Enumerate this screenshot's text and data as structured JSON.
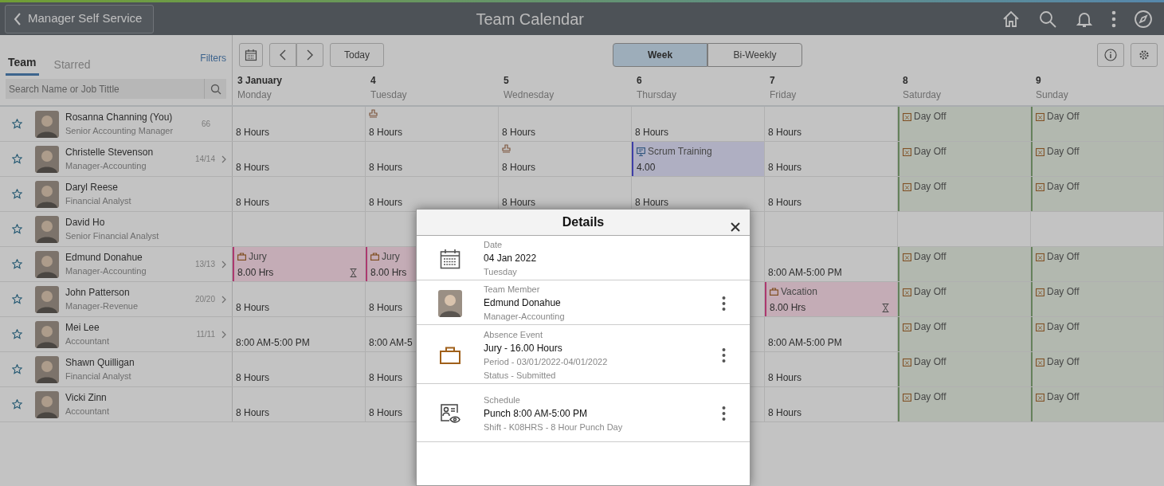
{
  "header": {
    "back_label": "Manager Self Service",
    "title": "Team Calendar"
  },
  "sidebar": {
    "tabs": [
      {
        "label": "Team",
        "selected": true
      },
      {
        "label": "Starred",
        "selected": false
      }
    ],
    "filters": "Filters",
    "search": {
      "placeholder": "Search Name or Job Tittle"
    }
  },
  "toolbar": {
    "today": "Today",
    "views": [
      {
        "label": "Week",
        "selected": true
      },
      {
        "label": "Bi-Weekly",
        "selected": false
      }
    ]
  },
  "days": [
    {
      "date": "3 January",
      "weekday": "Monday"
    },
    {
      "date": "4",
      "weekday": "Tuesday"
    },
    {
      "date": "5",
      "weekday": "Wednesday"
    },
    {
      "date": "6",
      "weekday": "Thursday"
    },
    {
      "date": "7",
      "weekday": "Friday"
    },
    {
      "date": "8",
      "weekday": "Saturday"
    },
    {
      "date": "9",
      "weekday": "Sunday"
    }
  ],
  "rows": [
    {
      "name": "Rosanna Channing (You)",
      "job": "Senior Accounting Manager",
      "count": "66",
      "expandable": false,
      "starred": false,
      "cells": [
        {
          "kind": "hours",
          "text": "8 Hours"
        },
        {
          "kind": "hours",
          "text": "8 Hours",
          "flagged": true
        },
        {
          "kind": "hours",
          "text": "8 Hours"
        },
        {
          "kind": "hours",
          "text": "8 Hours"
        },
        {
          "kind": "hours",
          "text": "8 Hours"
        },
        {
          "kind": "dayoff",
          "title": "Day Off"
        },
        {
          "kind": "dayoff",
          "title": "Day Off"
        }
      ]
    },
    {
      "name": "Christelle Stevenson",
      "job": "Manager-Accounting",
      "count": "14/14",
      "expandable": true,
      "starred": false,
      "cells": [
        {
          "kind": "hours",
          "text": "8 Hours"
        },
        {
          "kind": "hours",
          "text": "8 Hours"
        },
        {
          "kind": "hours",
          "text": "8 Hours",
          "flagged": true
        },
        {
          "kind": "training",
          "title": "Scrum Training",
          "text": "4.00"
        },
        {
          "kind": "hours",
          "text": "8 Hours"
        },
        {
          "kind": "dayoff",
          "title": "Day Off"
        },
        {
          "kind": "dayoff",
          "title": "Day Off"
        }
      ]
    },
    {
      "name": "Daryl Reese",
      "job": "Financial Analyst",
      "starred": false,
      "cells": [
        {
          "kind": "hours",
          "text": "8 Hours"
        },
        {
          "kind": "hours",
          "text": "8 Hours"
        },
        {
          "kind": "hours",
          "text": "8 Hours"
        },
        {
          "kind": "hours",
          "text": "8 Hours"
        },
        {
          "kind": "hours",
          "text": "8 Hours"
        },
        {
          "kind": "dayoff",
          "title": "Day Off"
        },
        {
          "kind": "dayoff",
          "title": "Day Off"
        }
      ]
    },
    {
      "name": "David Ho",
      "job": "Senior Financial Analyst",
      "starred": false,
      "cells": [
        {
          "kind": "empty"
        },
        {
          "kind": "empty"
        },
        {
          "kind": "empty"
        },
        {
          "kind": "empty"
        },
        {
          "kind": "empty"
        },
        {
          "kind": "empty"
        },
        {
          "kind": "empty"
        }
      ]
    },
    {
      "name": "Edmund Donahue",
      "job": "Manager-Accounting",
      "count": "13/13",
      "expandable": true,
      "starred": false,
      "cells": [
        {
          "kind": "absence",
          "title": "Jury",
          "text": "8.00 Hrs",
          "pending": true
        },
        {
          "kind": "absence",
          "title": "Jury",
          "text": "8.00 Hrs"
        },
        {
          "kind": "empty"
        },
        {
          "kind": "empty"
        },
        {
          "kind": "hours",
          "text": "8:00 AM-5:00 PM"
        },
        {
          "kind": "dayoff",
          "title": "Day Off"
        },
        {
          "kind": "dayoff",
          "title": "Day Off"
        }
      ]
    },
    {
      "name": "John Patterson",
      "job": "Manager-Revenue",
      "count": "20/20",
      "expandable": true,
      "starred": false,
      "cells": [
        {
          "kind": "hours",
          "text": "8 Hours"
        },
        {
          "kind": "hours",
          "text": "8 Hours"
        },
        {
          "kind": "empty"
        },
        {
          "kind": "empty"
        },
        {
          "kind": "absence",
          "title": "Vacation",
          "text": "8.00 Hrs",
          "pending": true
        },
        {
          "kind": "dayoff",
          "title": "Day Off"
        },
        {
          "kind": "dayoff",
          "title": "Day Off"
        }
      ]
    },
    {
      "name": "Mei Lee",
      "job": "Accountant",
      "count": "11/11",
      "expandable": true,
      "starred": false,
      "cells": [
        {
          "kind": "hours",
          "text": "8:00 AM-5:00 PM"
        },
        {
          "kind": "hours",
          "text": "8:00 AM-5"
        },
        {
          "kind": "empty"
        },
        {
          "kind": "empty"
        },
        {
          "kind": "hours",
          "text": "8:00 AM-5:00 PM"
        },
        {
          "kind": "dayoff",
          "title": "Day Off"
        },
        {
          "kind": "dayoff",
          "title": "Day Off"
        }
      ]
    },
    {
      "name": "Shawn Quilligan",
      "job": "Financial Analyst",
      "starred": false,
      "cells": [
        {
          "kind": "hours",
          "text": "8 Hours"
        },
        {
          "kind": "hours",
          "text": "8 Hours"
        },
        {
          "kind": "empty"
        },
        {
          "kind": "empty"
        },
        {
          "kind": "hours",
          "text": "8 Hours"
        },
        {
          "kind": "dayoff",
          "title": "Day Off"
        },
        {
          "kind": "dayoff",
          "title": "Day Off"
        }
      ]
    },
    {
      "name": "Vicki Zinn",
      "job": "Accountant",
      "starred": false,
      "cells": [
        {
          "kind": "hours",
          "text": "8 Hours"
        },
        {
          "kind": "hours",
          "text": "8 Hours"
        },
        {
          "kind": "empty"
        },
        {
          "kind": "empty"
        },
        {
          "kind": "hours",
          "text": "8 Hours"
        },
        {
          "kind": "dayoff",
          "title": "Day Off"
        },
        {
          "kind": "dayoff",
          "title": "Day Off"
        }
      ]
    }
  ],
  "details": {
    "title": "Details",
    "sections": [
      {
        "kind": "date",
        "label": "Date",
        "lines": [
          "04 Jan 2022",
          "Tuesday"
        ],
        "menu": false
      },
      {
        "kind": "member",
        "label": "Team Member",
        "lines": [
          "Edmund Donahue",
          "Manager-Accounting"
        ],
        "menu": true
      },
      {
        "kind": "absence",
        "label": "Absence Event",
        "lines": [
          "Jury - 16.00 Hours",
          "Period - 03/01/2022-04/01/2022",
          "Status - Submitted"
        ],
        "menu": true
      },
      {
        "kind": "schedule",
        "label": "Schedule",
        "lines": [
          "Punch 8:00 AM-5:00 PM",
          "Shift - K08HRS - 8 Hour Punch Day"
        ],
        "menu": true
      }
    ]
  }
}
